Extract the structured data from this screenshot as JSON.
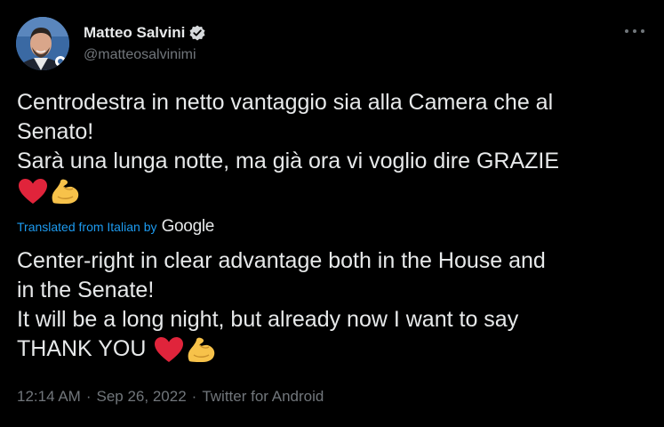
{
  "user": {
    "display_name": "Matteo Salvini",
    "handle": "@matteosalvinimi"
  },
  "tweet": {
    "original_lines": [
      "Centrodestra in netto vantaggio sia alla Camera che al",
      "Senato!",
      "Sarà una lunga notte, ma già ora vi voglio dire GRAZIE"
    ],
    "translation_label": "Translated from Italian",
    "translation_by": "by",
    "translation_provider": "Google",
    "translated_lines": [
      "Center-right in clear advantage both in the House and",
      "in the Senate!",
      "It will be a long night, but already now I want to say"
    ],
    "translated_last_line": "THANK YOU",
    "time": "12:14 AM",
    "date": "Sep 26, 2022",
    "source": "Twitter for Android",
    "separator": "·"
  },
  "icons": {
    "verified": "verified-badge-icon",
    "more": "more-options-icon",
    "heart": "red-heart-emoji",
    "biceps": "flexed-biceps-emoji"
  },
  "colors": {
    "background": "#000000",
    "text": "#e7e9ea",
    "secondary": "#71767b",
    "link": "#1d9bf0",
    "heart": "#e0243b",
    "biceps": "#f7c24a"
  }
}
